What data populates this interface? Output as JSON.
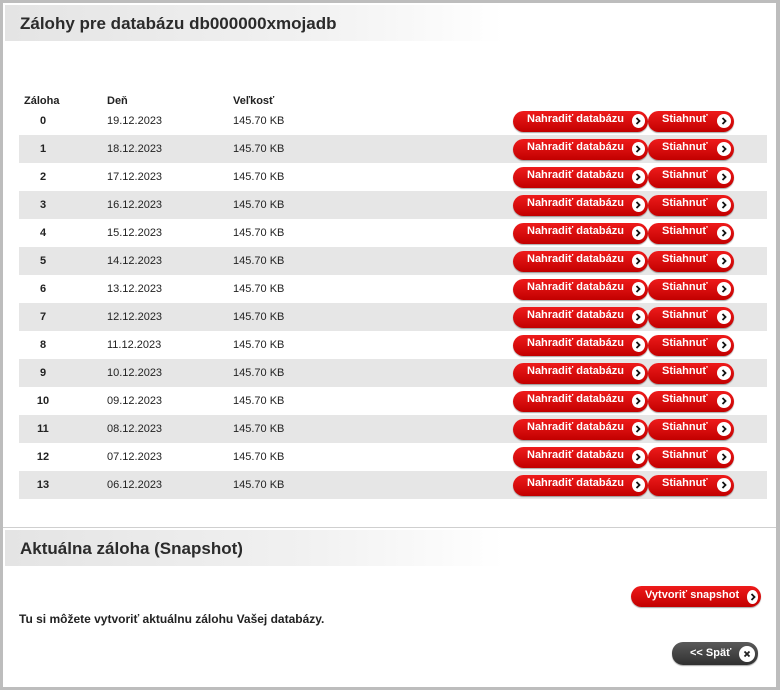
{
  "backups_panel": {
    "title": "Zálohy pre databázu db000000xmojadb",
    "columns": {
      "backup": "Záloha",
      "day": "Deň",
      "size": "Veľkosť"
    },
    "replace_label": "Nahradiť databázu",
    "download_label": "Stiahnuť",
    "rows": [
      {
        "backup": "0",
        "day": "19.12.2023",
        "size": "145.70 KB"
      },
      {
        "backup": "1",
        "day": "18.12.2023",
        "size": "145.70 KB"
      },
      {
        "backup": "2",
        "day": "17.12.2023",
        "size": "145.70 KB"
      },
      {
        "backup": "3",
        "day": "16.12.2023",
        "size": "145.70 KB"
      },
      {
        "backup": "4",
        "day": "15.12.2023",
        "size": "145.70 KB"
      },
      {
        "backup": "5",
        "day": "14.12.2023",
        "size": "145.70 KB"
      },
      {
        "backup": "6",
        "day": "13.12.2023",
        "size": "145.70 KB"
      },
      {
        "backup": "7",
        "day": "12.12.2023",
        "size": "145.70 KB"
      },
      {
        "backup": "8",
        "day": "11.12.2023",
        "size": "145.70 KB"
      },
      {
        "backup": "9",
        "day": "10.12.2023",
        "size": "145.70 KB"
      },
      {
        "backup": "10",
        "day": "09.12.2023",
        "size": "145.70 KB"
      },
      {
        "backup": "11",
        "day": "08.12.2023",
        "size": "145.70 KB"
      },
      {
        "backup": "12",
        "day": "07.12.2023",
        "size": "145.70 KB"
      },
      {
        "backup": "13",
        "day": "06.12.2023",
        "size": "145.70 KB"
      }
    ]
  },
  "snapshot_panel": {
    "title": "Aktuálna záloha (Snapshot)",
    "description": "Tu si môžete vytvoriť aktuálnu zálohu Vašej databázy.",
    "create_label": "Vytvoriť snapshot"
  },
  "back_label": "<< Späť",
  "colors": {
    "accent_red": "#d80000",
    "back_button": "#404040",
    "row_stripe": "#e6e6e6"
  },
  "icons": {
    "action_arrow": "chevron-right-circle-icon",
    "back_close": "close-circle-icon"
  }
}
